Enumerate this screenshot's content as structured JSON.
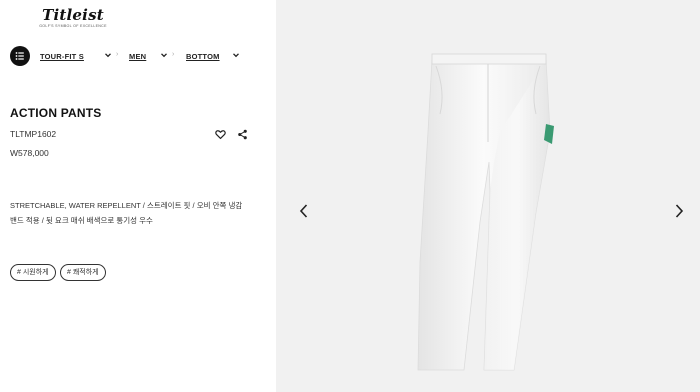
{
  "brand": {
    "logo_text": "Titleist",
    "tagline": "GOLF'S SYMBOL OF EXCELLENCE"
  },
  "breadcrumb": {
    "items": [
      {
        "label": "TOUR-FIT S"
      },
      {
        "label": "MEN"
      },
      {
        "label": "BOTTOM"
      }
    ]
  },
  "product": {
    "name": "ACTION PANTS",
    "code": "TLTMP1602",
    "price": "W578,000",
    "description_line1": "STRETCHABLE, WATER REPELLENT / 스트레이트 핏 / 오비 안쪽 냉감",
    "description_line2": "밴드 적용 / 뒷 요크 매쉬 배색으로 통기성 우수",
    "tags": [
      "# 시원하게",
      "# 쾌적하게"
    ]
  },
  "icons": {
    "menu": "list-icon",
    "wishlist": "heart-icon",
    "share": "share-icon",
    "prev": "chevron-left-icon",
    "next": "chevron-right-icon"
  },
  "colors": {
    "gallery_bg": "#f1f1f1",
    "pants": "#f6f6f6",
    "accent_green": "#3a9a72"
  }
}
